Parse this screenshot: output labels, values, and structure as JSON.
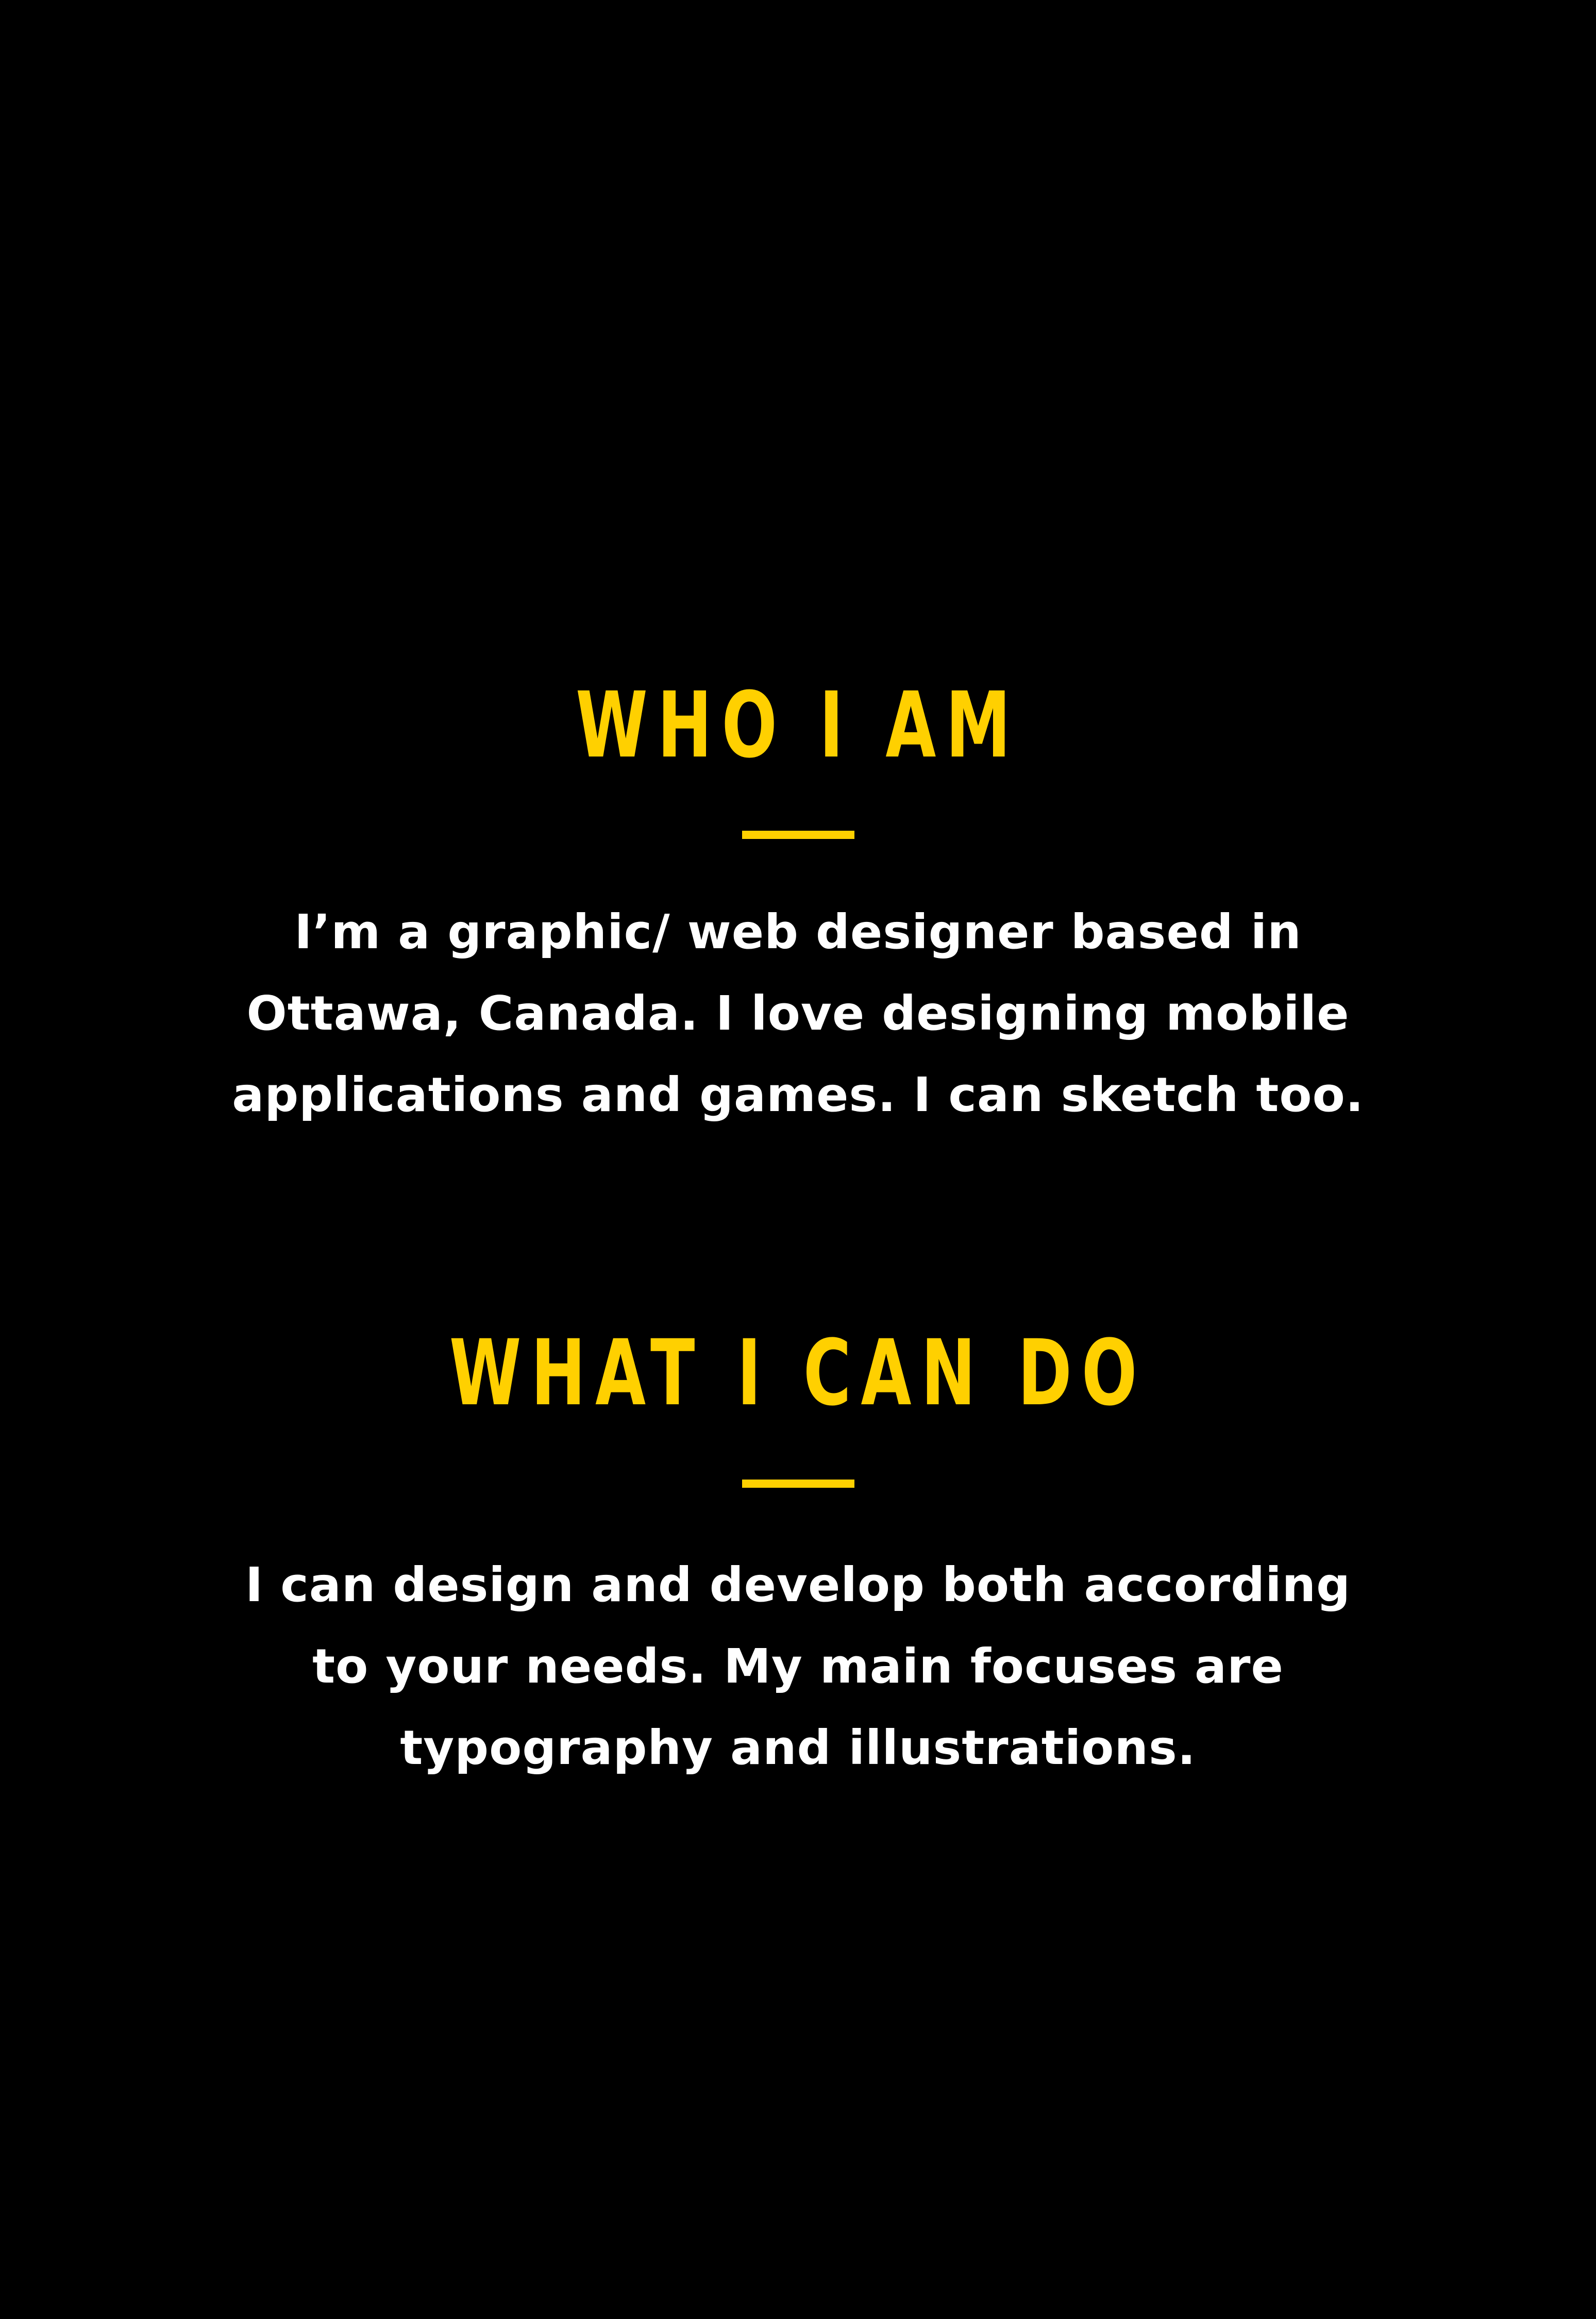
{
  "theme": {
    "background": "#000000",
    "accent": "#FFD000",
    "text": "#FFFFFF"
  },
  "sections": [
    {
      "heading": "WHO I AM",
      "lines": [
        "I’m a graphic/ web designer based in",
        "Ottawa, Canada. I love designing mobile",
        "applications and games. I can sketch too."
      ]
    },
    {
      "heading": "WHAT I CAN DO",
      "lines": [
        "I can design and develop both according",
        "to your needs. My main focuses are",
        "typography and illustrations."
      ]
    }
  ]
}
